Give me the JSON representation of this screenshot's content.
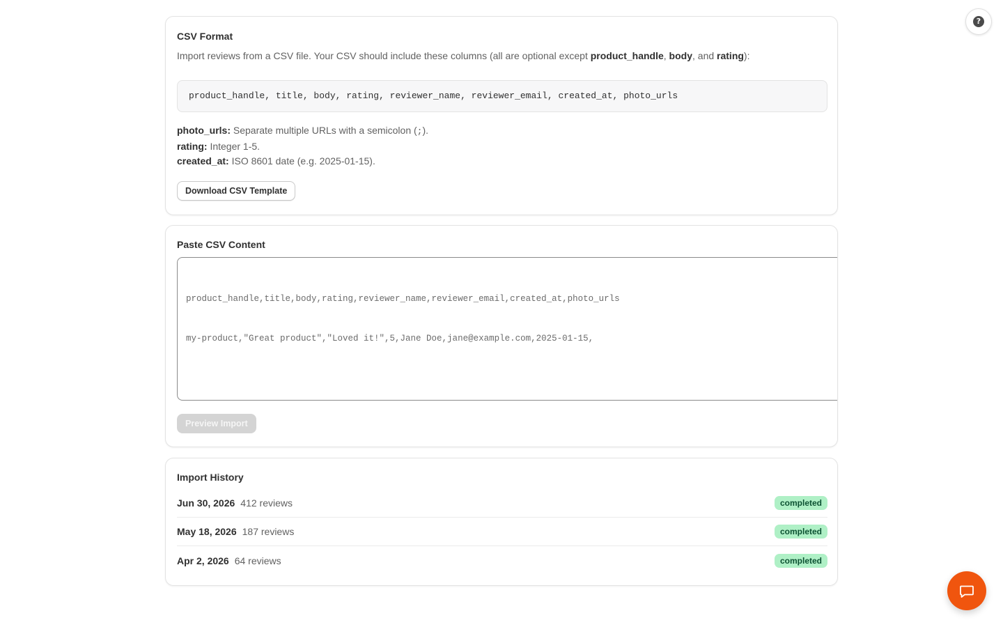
{
  "help": {
    "icon": "question-mark-icon",
    "glyph": "?"
  },
  "csv_format": {
    "title": "CSV Format",
    "intro_prefix": "Import reviews from a CSV file. Your CSV should include these columns (all are optional except ",
    "required_1": "product_handle",
    "sep_1": ", ",
    "required_2": "body",
    "sep_2": ", and ",
    "required_3": "rating",
    "intro_suffix": "):",
    "columns": "product_handle, title, body, rating, reviewer_name, reviewer_email, created_at, photo_urls",
    "notes": [
      {
        "label": "photo_urls:",
        "text_before": " Separate multiple URLs with a semicolon (",
        "code": ";",
        "text_after": ")."
      },
      {
        "label": "rating:",
        "text": " Integer 1-5."
      },
      {
        "label": "created_at:",
        "text": " ISO 8601 date (e.g. 2025-01-15)."
      }
    ],
    "download_label": "Download CSV Template"
  },
  "paste": {
    "title": "Paste CSV Content",
    "placeholder_line_1": "product_handle,title,body,rating,reviewer_name,reviewer_email,created_at,photo_urls",
    "placeholder_line_2": "my-product,\"Great product\",\"Loved it!\",5,Jane Doe,jane@example.com,2025-01-15,",
    "preview_label": "Preview Import"
  },
  "history": {
    "title": "Import History",
    "rows": [
      {
        "date": "Jun 30, 2026",
        "count": "412 reviews",
        "status": "completed"
      },
      {
        "date": "May 18, 2026",
        "count": "187 reviews",
        "status": "completed"
      },
      {
        "date": "Apr 2, 2026",
        "count": "64 reviews",
        "status": "completed"
      }
    ]
  },
  "chat": {
    "icon": "chat-bubble-icon"
  },
  "colors": {
    "badge_bg": "#aff0c6",
    "badge_text": "#0c5132",
    "chat_accent": "#f0550e",
    "disabled_button": "#d4d4d4"
  }
}
